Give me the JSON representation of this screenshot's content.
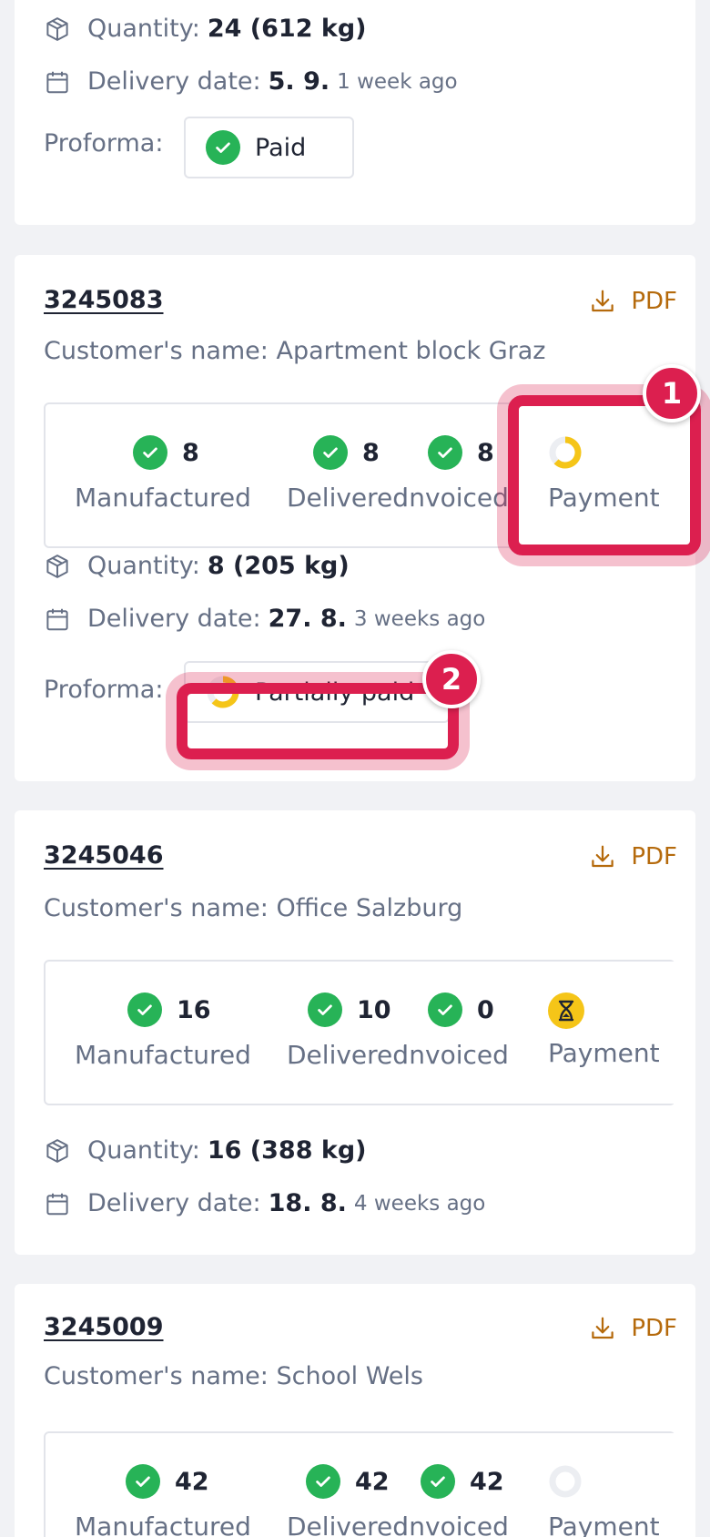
{
  "labels": {
    "quantity": "Quantity:",
    "delivery_date": "Delivery date:",
    "proforma": "Proforma:",
    "pdf": "PDF",
    "manufactured": "Manufactured",
    "delivered": "Delivered",
    "invoiced": "Invoiced",
    "payment": "Payment"
  },
  "card0": {
    "quantity": "24 (612 kg)",
    "delivery_date": "5. 9.",
    "delivery_ago": "1 week ago",
    "proforma_status": "Paid"
  },
  "card1": {
    "order_number": "3245083",
    "customer": "Customer's name: Apartment block Graz",
    "manufactured": "8",
    "delivered": "8",
    "invoiced": "8",
    "payment_status": "partial",
    "quantity": "8 (205 kg)",
    "delivery_date": "27. 8.",
    "delivery_ago": "3 weeks ago",
    "proforma_status": "Partially paid"
  },
  "card2": {
    "order_number": "3245046",
    "customer": "Customer's name: Office Salzburg",
    "manufactured": "16",
    "delivered": "10",
    "invoiced": "0",
    "payment_status": "pending",
    "quantity": "16 (388 kg)",
    "delivery_date": "18. 8.",
    "delivery_ago": "4 weeks ago"
  },
  "card3": {
    "order_number": "3245009",
    "customer": "Customer's name: School Wels",
    "manufactured": "42",
    "delivered": "42",
    "invoiced": "42",
    "payment_status": "empty"
  },
  "annotations": {
    "badge1": "1",
    "badge2": "2"
  },
  "colors": {
    "check_green": "#27b357",
    "partial_yellow": "#f5c518",
    "highlight_red": "#dc1f4f",
    "pdf_orange": "#b56a0c"
  }
}
